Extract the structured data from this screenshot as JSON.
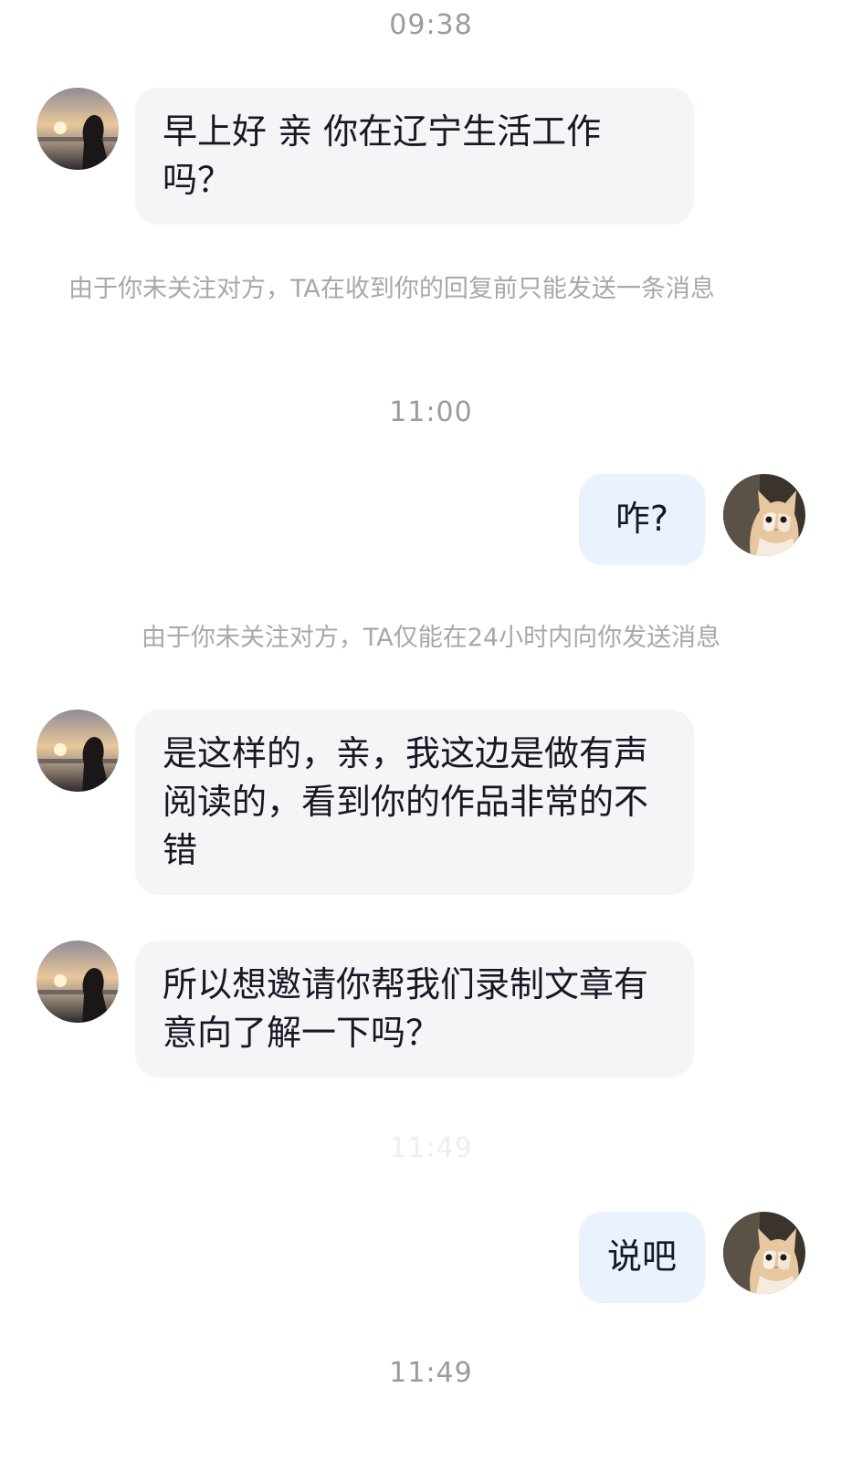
{
  "timestamps": {
    "t1": "09:38",
    "t2": "11:00",
    "t3": "11:49",
    "t4": "11:49"
  },
  "notices": {
    "n1": "由于你未关注对方，TA在收到你的回复前只能发送一条消息",
    "n2": "由于你未关注对方，TA仅能在24小时内向你发送消息"
  },
  "messages": [
    {
      "from": "other",
      "text": "早上好 亲 你在辽宁生活工作吗？"
    },
    {
      "from": "me",
      "text": "咋?"
    },
    {
      "from": "other",
      "text": "是这样的，亲，我这边是做有声阅读的，看到你的作品非常的不错"
    },
    {
      "from": "other",
      "text": "所以想邀请你帮我们录制文章有意向了解一下吗？"
    },
    {
      "from": "me",
      "text": "说吧"
    }
  ],
  "avatars": {
    "other": "silhouette-sunset-avatar",
    "me": "kitten-avatar"
  },
  "colors": {
    "incoming_bubble": "#f4f5f7",
    "outgoing_bubble": "#e9f2fd",
    "meta_text": "#9a9ba1"
  }
}
